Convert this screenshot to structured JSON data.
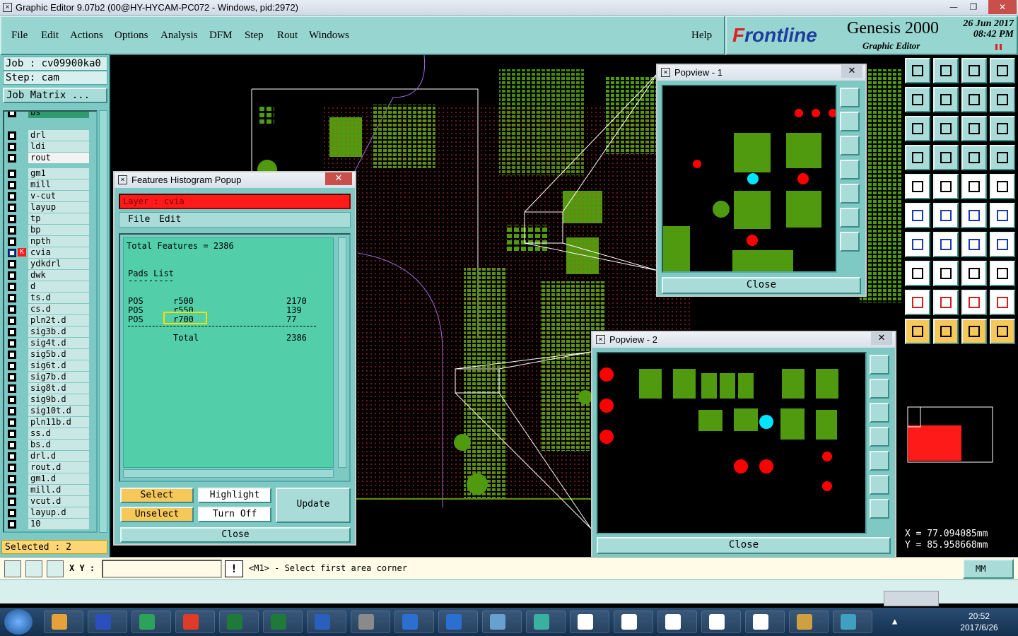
{
  "window": {
    "title": "Graphic Editor 9.07b2 (00@HY-HYCAM-PC072 - Windows, pid:2972)"
  },
  "menu": {
    "items": [
      "File",
      "Edit",
      "Actions",
      "Options",
      "Analysis",
      "DFM",
      "Step",
      "Rout",
      "Windows"
    ],
    "help": "Help"
  },
  "brand": {
    "logo_prefix": "F",
    "logo_rest": "rontline",
    "product": "Genesis 2000",
    "subtitle": "Graphic Editor",
    "date": "26 Jun 2017",
    "time": "08:42 PM"
  },
  "job": {
    "job_label": "Job : cv09900ka0",
    "step_label": "Step: cam",
    "matrix_button": "Job Matrix ..."
  },
  "layers": [
    "bs",
    "drl",
    "ldi",
    "rout",
    "gm1",
    "mill",
    "v-cut",
    "layup",
    "tp",
    "bp",
    "npth",
    "cvia",
    "ydkdrl",
    "dwk",
    "d",
    "ts.d",
    "cs.d",
    "pln2t.d",
    "sig3b.d",
    "sig4t.d",
    "sig5b.d",
    "sig6t.d",
    "sig7b.d",
    "sig8t.d",
    "sig9b.d",
    "sig10t.d",
    "pln11b.d",
    "ss.d",
    "bs.d",
    "drl.d",
    "rout.d",
    "gm1.d",
    "mill.d",
    "vcut.d",
    "layup.d",
    "10"
  ],
  "selected": "Selected : 2",
  "histogram": {
    "title": "Features Histogram Popup",
    "layer_label": "Layer :",
    "layer_value": "cvia",
    "menu_file": "File",
    "menu_edit": "Edit",
    "total": "Total Features = 2386",
    "section": "Pads List",
    "rule": "---------",
    "rows": [
      [
        "POS",
        "r500",
        "2170"
      ],
      [
        "POS",
        "r550",
        "139"
      ],
      [
        "POS",
        "r700",
        "77"
      ]
    ],
    "total_label": "Total",
    "total_value": "2386",
    "buttons": {
      "select": "Select",
      "highlight": "Highlight",
      "unselect": "Unselect",
      "turnoff": "Turn Off",
      "update": "Update",
      "close": "Close"
    }
  },
  "popview1": {
    "title": "Popview - 1",
    "close": "Close"
  },
  "popview2": {
    "title": "Popview - 2",
    "close": "Close"
  },
  "coords": {
    "x": "X = 77.094085mm",
    "y": "Y = 85.958668mm"
  },
  "status": {
    "xy_label": "X Y :",
    "message": "<M1> - Select first area corner",
    "units": "MM"
  },
  "taskbar": {
    "clock_time": "20:52",
    "clock_date": "2017/6/26"
  },
  "colors": {
    "panel": "#7ec9c3",
    "pad": "#4f9a0e",
    "accent_red": "#ff0000",
    "highlight": "#f6c85a"
  }
}
